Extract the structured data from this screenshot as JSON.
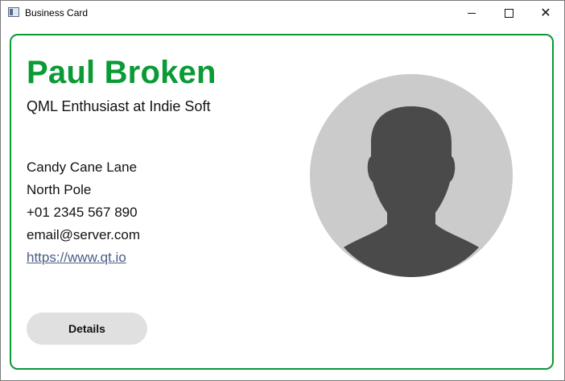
{
  "window": {
    "title": "Business Card",
    "minimize_glyph": "",
    "maximize_glyph": "",
    "close_glyph": "✕"
  },
  "card": {
    "name": "Paul Broken",
    "role": "QML Enthusiast at Indie Soft",
    "address_line1": "Candy Cane Lane",
    "address_line2": "North Pole",
    "phone": "+01 2345 567 890",
    "email": "email@server.com",
    "website": "https://www.qt.io",
    "details_label": "Details",
    "avatar_icon": "person-silhouette-icon"
  },
  "colors": {
    "accent": "#0a9a36",
    "link": "#4a5d86",
    "button_bg": "#e0e0e0",
    "avatar_bg": "#cbcbcb",
    "avatar_figure": "#4a4a4a"
  }
}
